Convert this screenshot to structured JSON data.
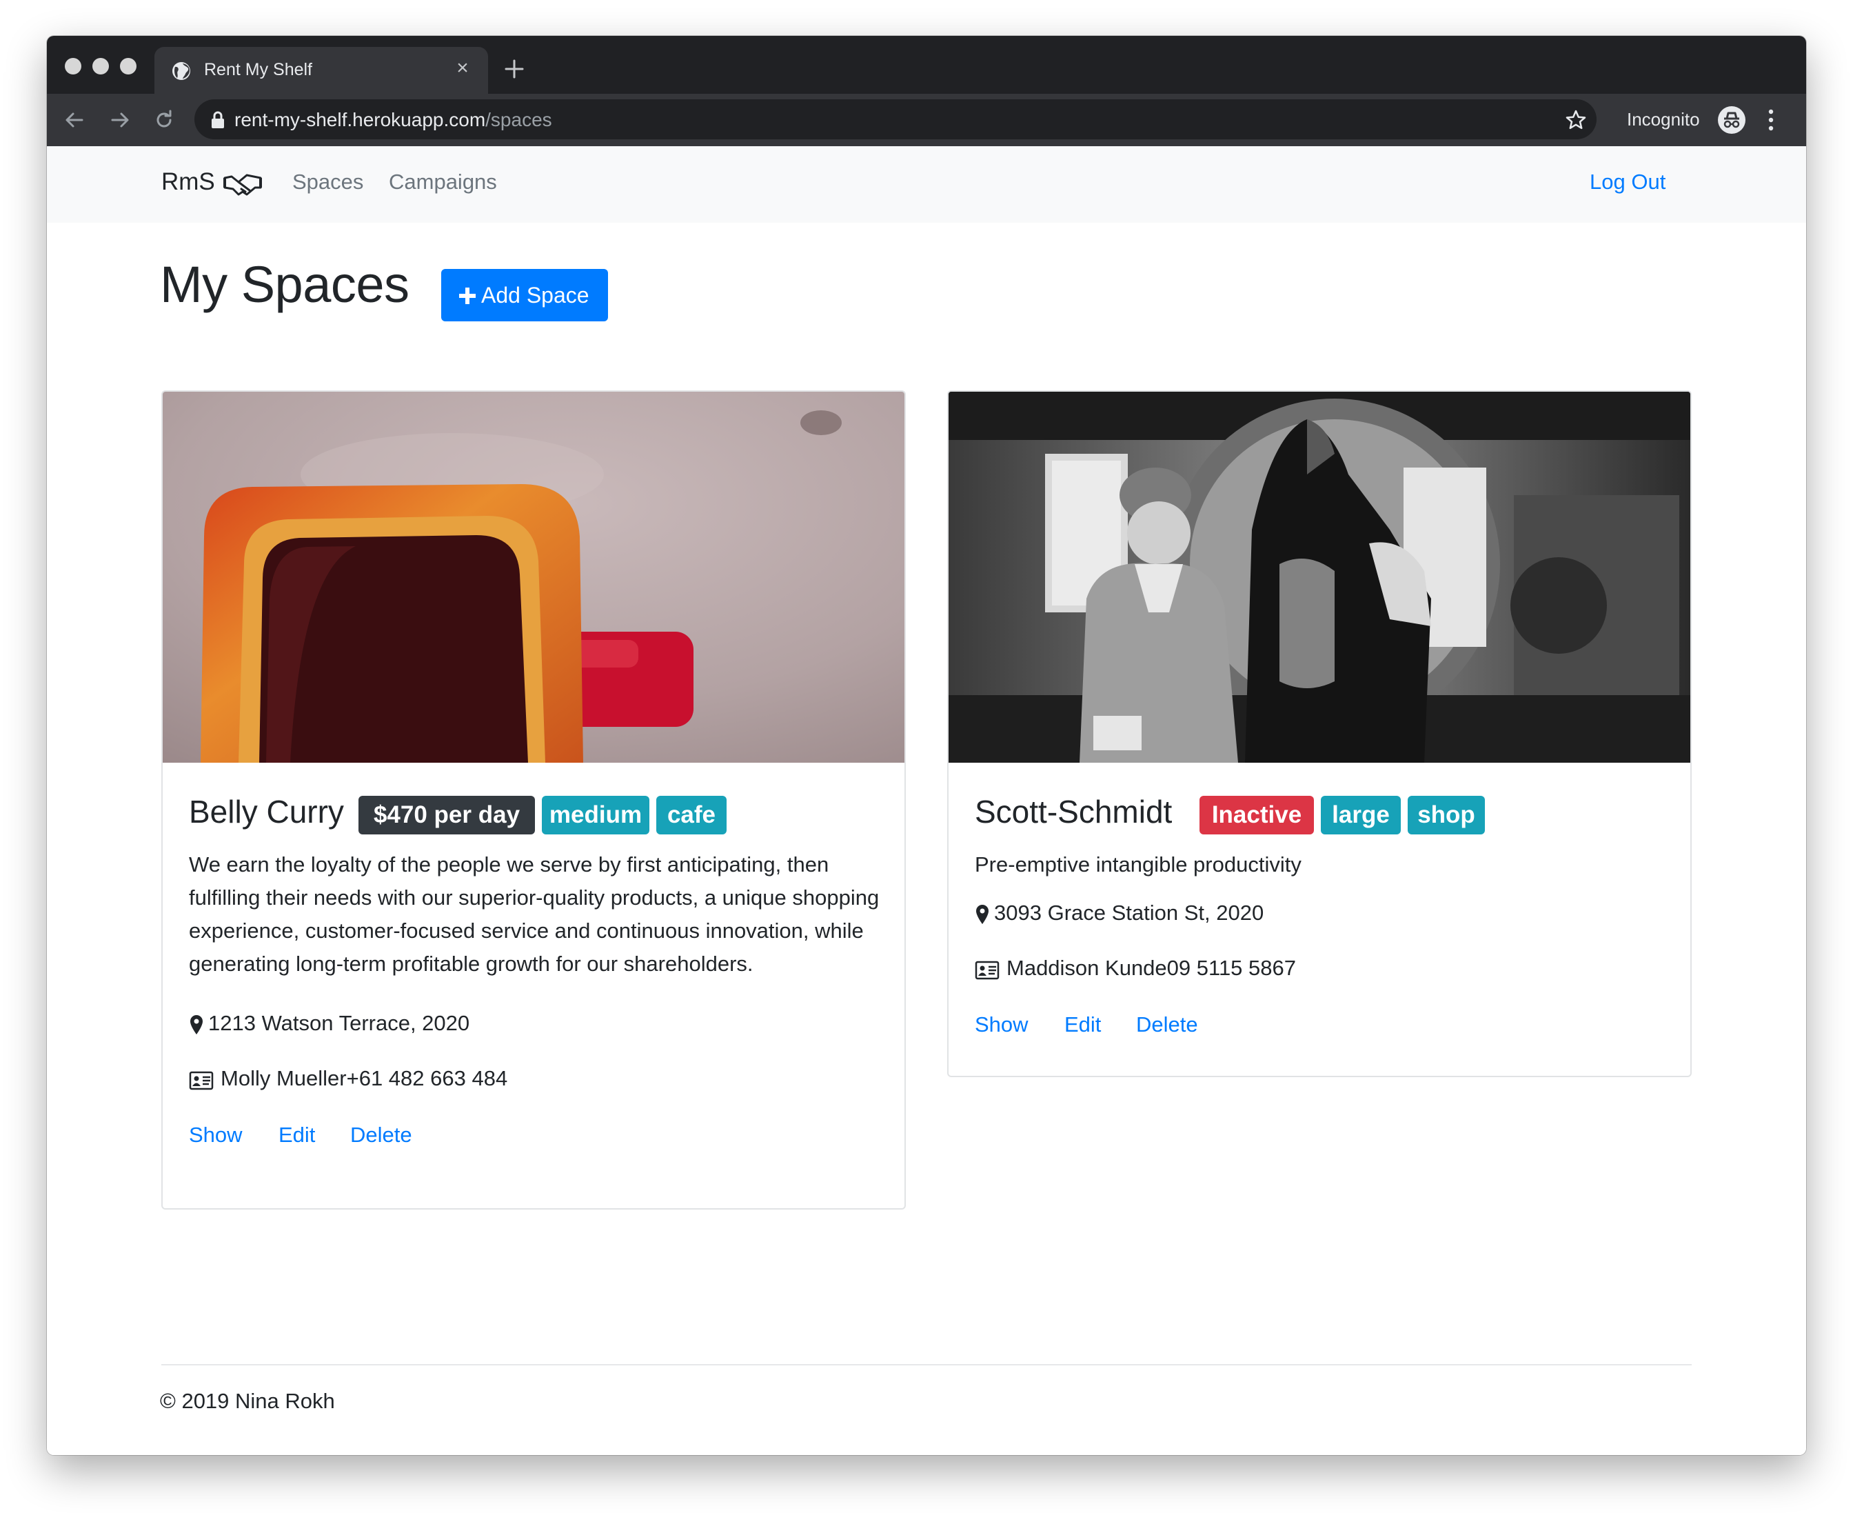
{
  "browser": {
    "tab_title": "Rent My Shelf",
    "close_glyph": "×",
    "url_host": "rent-my-shelf.herokuapp.com",
    "url_path": "/spaces",
    "profile_label": "Incognito"
  },
  "navbar": {
    "brand": "RmS",
    "links": [
      "Spaces",
      "Campaigns"
    ],
    "logout": "Log Out"
  },
  "main": {
    "heading": "My Spaces",
    "add_button": "Add Space"
  },
  "spaces": [
    {
      "title": "Belly Curry",
      "price_badge": "$470 per day",
      "size_badge": "medium",
      "type_badge": "cafe",
      "description": "We earn the loyalty of the people we serve by first anticipating, then fulfilling their needs with our superior-quality products, a unique shopping experience, customer-focused service and continuous innovation, while generating long-term profitable growth for our shareholders.",
      "address": "1213 Watson Terrace, 2020",
      "contact": "Molly Mueller+61 482 663 484",
      "links": [
        "Show",
        "Edit",
        "Delete"
      ]
    },
    {
      "title": "Scott-Schmidt",
      "status_badge": "Inactive",
      "size_badge": "large",
      "type_badge": "shop",
      "description": "Pre-emptive intangible productivity",
      "address": "3093 Grace Station St, 2020",
      "contact": "Maddison Kunde09 5115 5867",
      "links": [
        "Show",
        "Edit",
        "Delete"
      ]
    }
  ],
  "footer": {
    "copyright": "© 2019 Nina Rokh"
  },
  "colors": {
    "primary": "#007bff",
    "badge_dark": "#343a40",
    "badge_info": "#17a2b8",
    "badge_danger": "#dc3545"
  }
}
